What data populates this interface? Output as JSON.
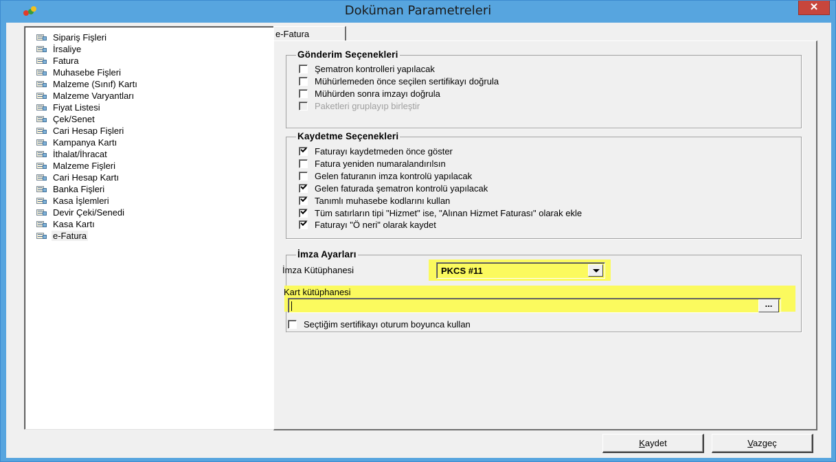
{
  "window": {
    "title": "Doküman Parametreleri",
    "close_glyph": "✕"
  },
  "tree": {
    "items": [
      "Sipariş Fişleri",
      "İrsaliye",
      "Fatura",
      "Muhasebe Fişleri",
      "Malzeme (Sınıf) Kartı",
      "Malzeme Varyantları",
      "Fiyat Listesi",
      "Çek/Senet",
      "Cari Hesap Fişleri",
      "Kampanya Kartı",
      "İthalat/İhracat",
      "Malzeme Fişleri",
      "Cari Hesap Kartı",
      "Banka Fişleri",
      "Kasa İşlemleri",
      "Devir Çeki/Senedi",
      "Kasa Kartı",
      "e-Fatura"
    ],
    "selected": "e-Fatura"
  },
  "tab": {
    "label": "e-Fatura"
  },
  "gonderim": {
    "title": "Gönderim Seçenekleri",
    "options": [
      {
        "label": "Şematron kontrolleri yapılacak",
        "checked": false,
        "disabled": false
      },
      {
        "label": "Mühürlemeden önce seçilen sertifikayı doğrula",
        "checked": false,
        "disabled": false
      },
      {
        "label": "Mühürden sonra imzayı doğrula",
        "checked": false,
        "disabled": false
      },
      {
        "label": "Paketleri gruplayıp birleştir",
        "checked": false,
        "disabled": true
      }
    ]
  },
  "kaydetme": {
    "title": "Kaydetme Seçenekleri",
    "options": [
      {
        "label": "Faturayı kaydetmeden önce göster",
        "checked": true
      },
      {
        "label": "Fatura yeniden numaralandırılsın",
        "checked": false
      },
      {
        "label": "Gelen faturanın imza kontrolü yapılacak",
        "checked": false
      },
      {
        "label": "Gelen faturada şematron kontrolü yapılacak",
        "checked": true
      },
      {
        "label": "Tanımlı muhasebe kodlarını kullan",
        "checked": true
      },
      {
        "label": "Tüm satırların tipi \"Hizmet\" ise, \"Alınan Hizmet Faturası\" olarak ekle",
        "checked": true
      },
      {
        "label": "Faturayı \"Ö neri\" olarak kaydet",
        "checked": true
      }
    ]
  },
  "imza": {
    "title": "İmza Ayarları",
    "kutuphane_label": "İmza Kütüphanesi",
    "kutuphane_value": "PKCS #11",
    "kart_label": "Kart kütüphanesi",
    "kart_value": "",
    "browse_label": "...",
    "session_label": "Seçtiğim sertifikayı oturum boyunca kullan",
    "session_checked": false
  },
  "buttons": {
    "save_mnemonic": "K",
    "save_rest": "aydet",
    "cancel_mnemonic": "V",
    "cancel_rest": "azgeç"
  },
  "colors": {
    "titlebar": "#57a5df",
    "highlight": "#fbfa5e",
    "close": "#c7463c"
  }
}
